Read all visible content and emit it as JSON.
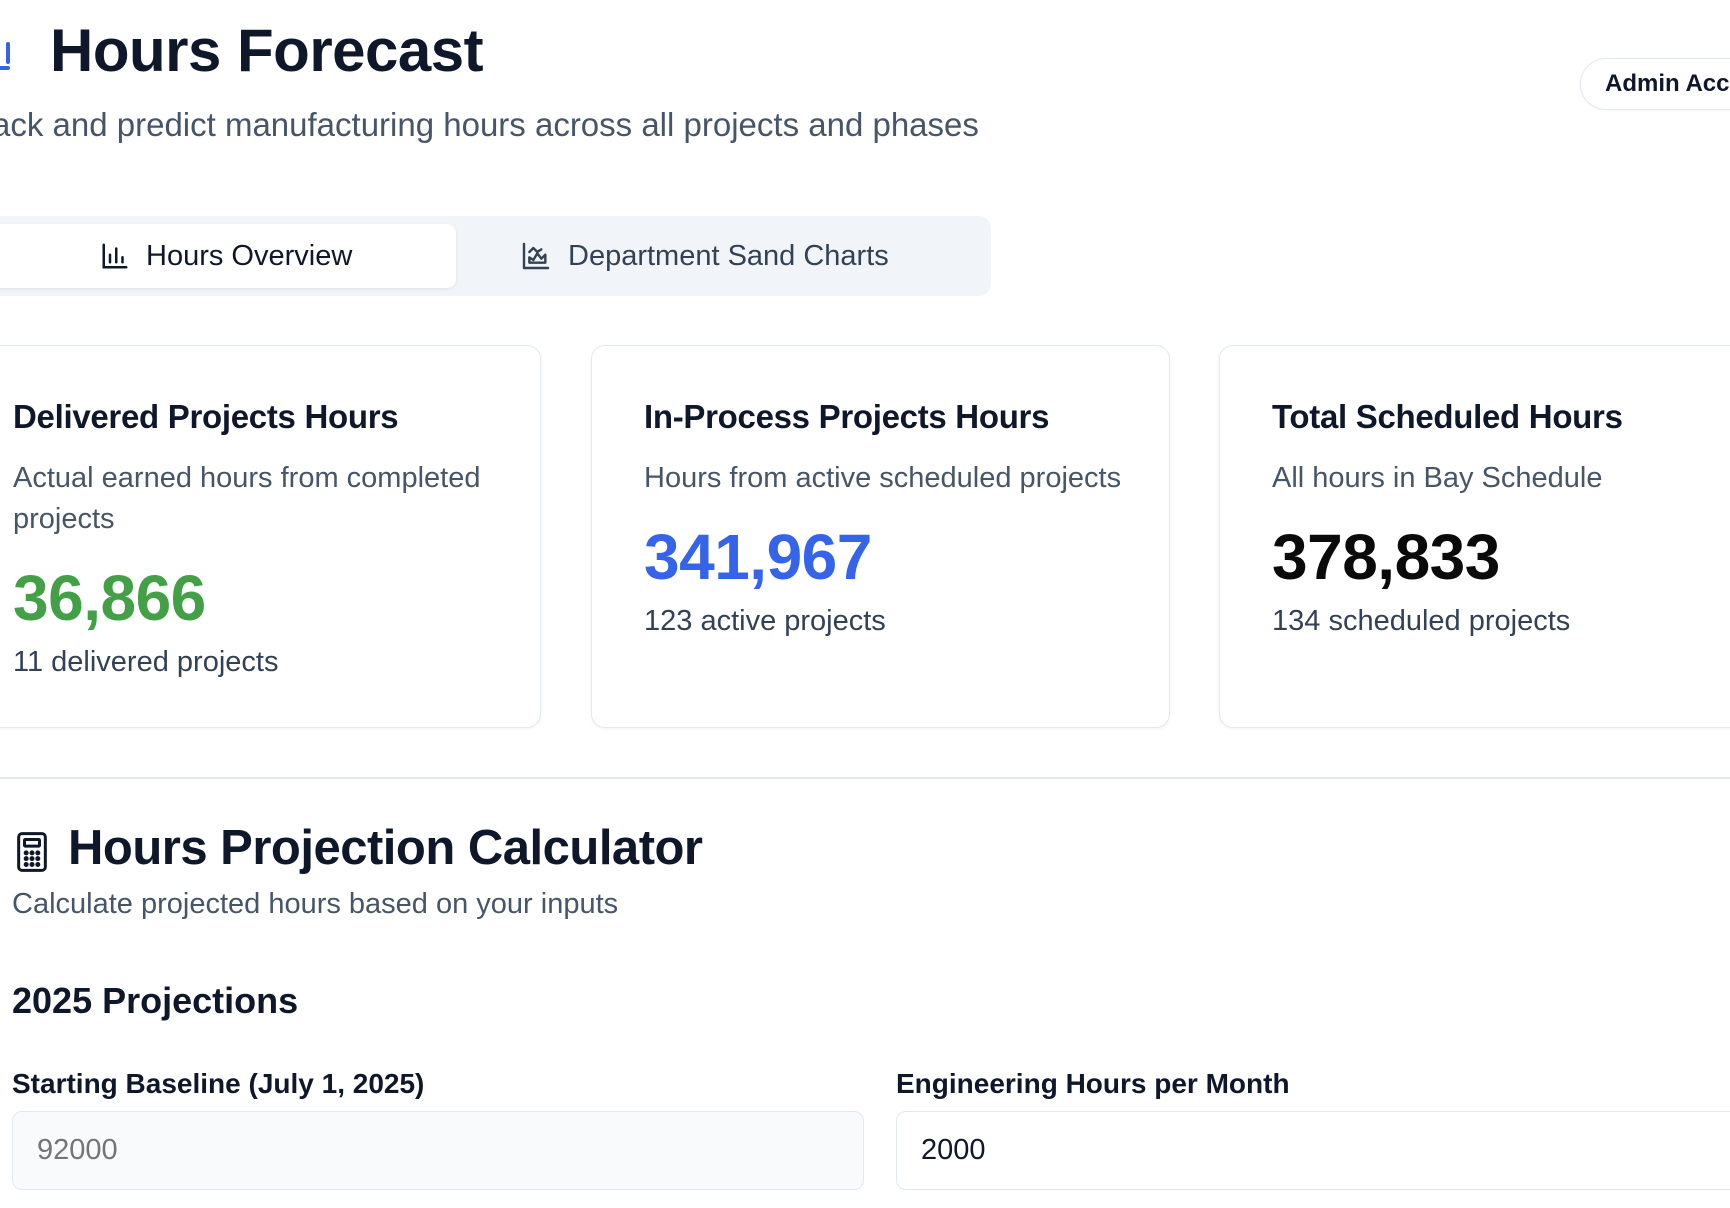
{
  "header": {
    "title": "Hours Forecast",
    "subtitle": "ack and predict manufacturing hours across all projects and phases",
    "admin_button": "Admin Acc",
    "icon": "bar-chart-icon"
  },
  "tabs": [
    {
      "label": "Hours Overview",
      "icon": "bar-chart-icon",
      "active": true
    },
    {
      "label": "Department Sand Charts",
      "icon": "area-chart-icon",
      "active": false
    }
  ],
  "cards": [
    {
      "title": "Delivered Projects Hours",
      "description": "Actual earned hours from completed projects",
      "value": "36,866",
      "footer": "11 delivered projects",
      "value_color": "#43a047"
    },
    {
      "title": "In-Process Projects Hours",
      "description": "Hours from active scheduled projects",
      "value": "341,967",
      "footer": "123 active projects",
      "value_color": "#3563e9"
    },
    {
      "title": "Total Scheduled Hours",
      "description": "All hours in Bay Schedule",
      "value": "378,833",
      "footer": "134 scheduled projects",
      "value_color": "#0a0a0a"
    }
  ],
  "calculator": {
    "icon": "calculator-icon",
    "title": "Hours Projection Calculator",
    "subtitle": "Calculate projected hours based on your inputs",
    "section_title": "2025 Projections",
    "fields": [
      {
        "label": "Starting Baseline (July 1, 2025)",
        "value": "",
        "placeholder": "92000"
      },
      {
        "label": "Engineering Hours per Month",
        "value": "2000",
        "placeholder": ""
      }
    ]
  },
  "colors": {
    "accent_blue": "#3563e9",
    "success_green": "#43a047",
    "border": "#e2e8f0",
    "muted_text": "#475569"
  }
}
